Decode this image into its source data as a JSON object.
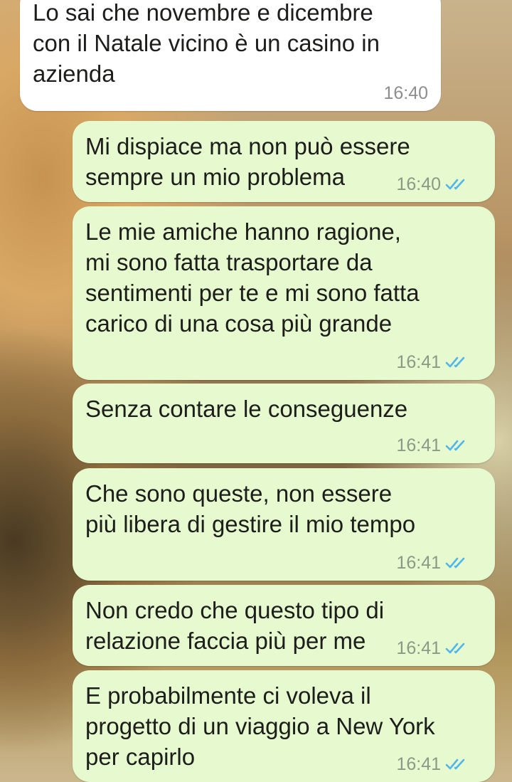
{
  "messages": [
    {
      "direction": "incoming",
      "text": "Lo sai che novembre e dicembre\ncon il Natale vicino è un casino in\nazienda",
      "time": "16:40"
    },
    {
      "direction": "outgoing",
      "text": "Mi dispiace ma non può essere\nsempre un mio problema",
      "time": "16:40",
      "status": "read-double-check"
    },
    {
      "direction": "outgoing",
      "text": "Le mie amiche hanno ragione,\nmi sono fatta trasportare da\nsentimenti per te e mi sono fatta\ncarico di una cosa più grande",
      "time": "16:41",
      "status": "read-double-check"
    },
    {
      "direction": "outgoing",
      "text": "Senza contare le conseguenze",
      "time": "16:41",
      "status": "read-double-check"
    },
    {
      "direction": "outgoing",
      "text": "Che sono queste, non essere\npiù libera di gestire il mio tempo",
      "time": "16:41",
      "status": "read-double-check"
    },
    {
      "direction": "outgoing",
      "text": "Non credo che questo tipo di\nrelazione faccia più per me",
      "time": "16:41",
      "status": "read-double-check"
    },
    {
      "direction": "outgoing",
      "text": "E probabilmente ci voleva il\nprogetto di un viaggio a New York\nper capirlo",
      "time": "16:41",
      "status": "read-double-check"
    }
  ],
  "colors": {
    "incoming_bubble": "#ffffff",
    "outgoing_bubble": "#e6f9cf",
    "read_ticks": "#4fb6ec"
  }
}
